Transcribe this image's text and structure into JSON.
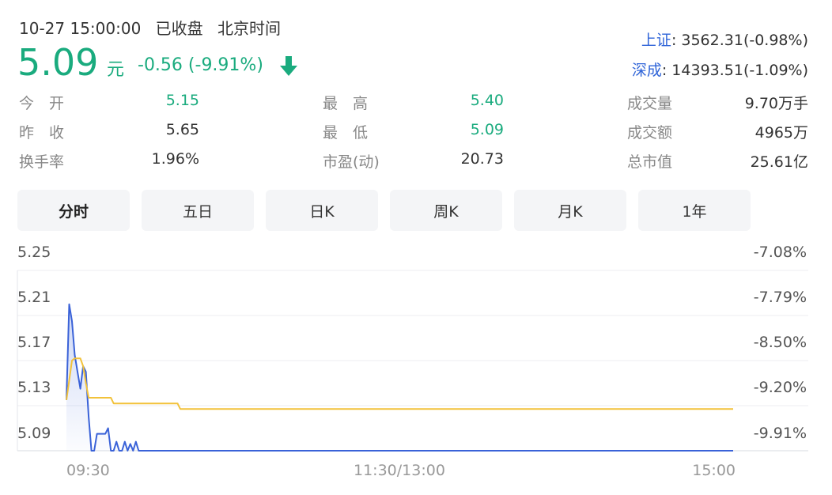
{
  "header": {
    "datetime": "10-27 15:00:00",
    "status": "已收盘",
    "timezone": "北京时间",
    "price": "5.09",
    "unit": "元",
    "change": "-0.56 (-9.91%)",
    "trend_icon": "down-arrow-icon",
    "accent_color": "#1aab7e"
  },
  "indices": [
    {
      "name": "上证",
      "value": ": 3562.31(-0.98%)"
    },
    {
      "name": "深成",
      "value": ": 14393.51(-1.09%)"
    }
  ],
  "stats": [
    {
      "label": "今　开",
      "value": "5.15",
      "green": true
    },
    {
      "label": "最　高",
      "value": "5.40",
      "green": true
    },
    {
      "label": "成交量",
      "value": "9.70万手",
      "green": false
    },
    {
      "label": "昨　收",
      "value": "5.65",
      "green": false
    },
    {
      "label": "最　低",
      "value": "5.09",
      "green": true
    },
    {
      "label": "成交额",
      "value": "4965万",
      "green": false
    },
    {
      "label": "换手率",
      "value": "1.96%",
      "green": false
    },
    {
      "label": "市盈(动)",
      "value": "20.73",
      "green": false
    },
    {
      "label": "总市值",
      "value": "25.61亿",
      "green": false
    }
  ],
  "tabs": [
    {
      "label": "分时",
      "active": true
    },
    {
      "label": "五日",
      "active": false
    },
    {
      "label": "日K",
      "active": false
    },
    {
      "label": "周K",
      "active": false
    },
    {
      "label": "月K",
      "active": false
    },
    {
      "label": "1年",
      "active": false
    }
  ],
  "chart_data": {
    "type": "line",
    "x_ticks": [
      "09:30",
      "11:30/13:00",
      "15:00"
    ],
    "y_ticks_left": [
      "5.25",
      "5.21",
      "5.17",
      "5.13",
      "5.09"
    ],
    "y_ticks_right": [
      "-7.08%",
      "-7.79%",
      "-8.50%",
      "-9.20%",
      "-9.91%"
    ],
    "ylim": [
      5.09,
      5.25
    ],
    "x_range": [
      0,
      240
    ],
    "grid": true,
    "series": [
      {
        "color": "#3a62d8",
        "fill": true,
        "points": [
          [
            0,
            5.135
          ],
          [
            1,
            5.22
          ],
          [
            2,
            5.205
          ],
          [
            3,
            5.175
          ],
          [
            4,
            5.16
          ],
          [
            5,
            5.145
          ],
          [
            6,
            5.165
          ],
          [
            7,
            5.16
          ],
          [
            8,
            5.12
          ],
          [
            9,
            5.09
          ],
          [
            10,
            5.09
          ],
          [
            11,
            5.105
          ],
          [
            12,
            5.105
          ],
          [
            14,
            5.105
          ],
          [
            15,
            5.11
          ],
          [
            16,
            5.09
          ],
          [
            17,
            5.088
          ],
          [
            18,
            5.098
          ],
          [
            19,
            5.088
          ],
          [
            20,
            5.088
          ],
          [
            21,
            5.098
          ],
          [
            22,
            5.088
          ],
          [
            23,
            5.096
          ],
          [
            24,
            5.088
          ],
          [
            25,
            5.098
          ],
          [
            26,
            5.088
          ],
          [
            27,
            5.088
          ],
          [
            240,
            5.088
          ]
        ]
      },
      {
        "color": "#f2c23a",
        "fill": false,
        "points": [
          [
            0,
            5.135
          ],
          [
            2,
            5.17
          ],
          [
            3,
            5.172
          ],
          [
            5,
            5.172
          ],
          [
            6,
            5.165
          ],
          [
            7,
            5.15
          ],
          [
            8,
            5.137
          ],
          [
            16,
            5.137
          ],
          [
            17,
            5.132
          ],
          [
            40,
            5.132
          ],
          [
            41,
            5.127
          ],
          [
            240,
            5.127
          ]
        ]
      }
    ]
  }
}
